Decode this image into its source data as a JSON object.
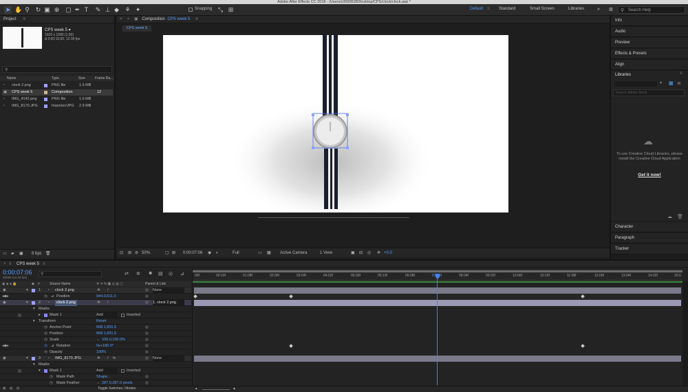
{
  "titlebar": {
    "title": "Adobe After Effects CC 2018 - /Users/s3699528/Desktop/CPS/clock/clock.aep *"
  },
  "toolbar": {
    "tools": [
      "selection-tool",
      "hand-tool",
      "zoom-tool",
      "rotate-tool",
      "camera-tool",
      "pan-behind-tool",
      "rectangle-tool",
      "pen-tool",
      "type-tool",
      "brush-tool",
      "clone-stamp-tool",
      "eraser-tool",
      "roto-brush-tool",
      "puppet-tool"
    ],
    "snapping_label": "Snapping",
    "workspaces": [
      "Default",
      "Standard",
      "Small Screen",
      "Libraries"
    ],
    "search_placeholder": "Search Help"
  },
  "project": {
    "header": "Project",
    "comp_name": "CPS week 5 ▾",
    "comp_info1": "1920 x 1080 (1.00)",
    "comp_info2": "Δ 0;00;15;00, 12.00 fps",
    "search_placeholder": "",
    "columns": [
      "Name",
      "Type",
      "Size",
      "Frame Ra..."
    ],
    "items": [
      {
        "name": "clock 2.png",
        "type": "PNG file",
        "size": "1.6 MB",
        "fps": "",
        "color": "#a0a0ff"
      },
      {
        "name": "CPS week 5",
        "type": "Composition",
        "size": "",
        "fps": "12",
        "color": "#c8b490"
      },
      {
        "name": "IMG_4142.png",
        "type": "PNG file",
        "size": "1.6 MB",
        "fps": "",
        "color": "#a0a0ff"
      },
      {
        "name": "IMG_8170.JPG",
        "type": "Importer/JPG",
        "size": "2.9 MB",
        "fps": "",
        "color": "#a0a0ff"
      }
    ],
    "bpc": "8 bpc"
  },
  "composition": {
    "header_prefix": "Composition",
    "header_name": "CPS week 5",
    "tab": "CPS week 5",
    "zoom": "50%",
    "timecode": "0:00:07:06",
    "resolution": "Full",
    "camera": "Active Camera",
    "views": "1 View",
    "exposure": "+0.0"
  },
  "right_panels": [
    "Info",
    "Audio",
    "Preview",
    "Effects & Presets",
    "Align",
    "Libraries"
  ],
  "libraries": {
    "search_placeholder": "Search Adobe Stock",
    "message": "To use Creative Cloud Libraries, please install the Creative Cloud Application",
    "link": "Get it now!"
  },
  "right_panels_bottom": [
    "Character",
    "Paragraph",
    "Tracker"
  ],
  "timeline": {
    "tab": "CPS week 5",
    "timecode": "0:00:07:06",
    "timecode_sub": "00090 (12.00 fps)",
    "col_source": "Source Name",
    "col_parent": "Parent & Link",
    "ruler": [
      "00f",
      "00:10f",
      "01:08f",
      "02:06f",
      "03:04f",
      "04:02f",
      "05:00f",
      "05:10f",
      "06:08f",
      "07:06f",
      "08:04f",
      "09:02f",
      "10:00f",
      "10:10f",
      "11:08f",
      "12:06f",
      "13:04f",
      "14:02f",
      "15:0"
    ],
    "toggle_label": "Toggle Switches / Modes",
    "rows": [
      {
        "kind": "layer",
        "num": "1",
        "name": "clock 2.png",
        "parent": "None"
      },
      {
        "kind": "prop",
        "name": "Position",
        "value": "944.0,611.0"
      },
      {
        "kind": "layer",
        "num": "2",
        "name": "clock 2.png",
        "parent": "1. clock 2.png"
      },
      {
        "kind": "group",
        "name": "Masks"
      },
      {
        "kind": "mask",
        "name": "Mask 1",
        "mode": "Add",
        "inverted": "Inverted"
      },
      {
        "kind": "group",
        "name": "Transform",
        "value": "Reset"
      },
      {
        "kind": "prop",
        "name": "Anchor Point",
        "value": "668.1,831.5"
      },
      {
        "kind": "prop",
        "name": "Position",
        "value": "668.1,831.5"
      },
      {
        "kind": "prop",
        "name": "Scale",
        "value": "100.0,100.0%"
      },
      {
        "kind": "prop",
        "name": "Rotation",
        "value": "0x+180.0°"
      },
      {
        "kind": "prop",
        "name": "Opacity",
        "value": "100%"
      },
      {
        "kind": "layer",
        "num": "3",
        "name": "IMG_8170.JPG",
        "parent": "None"
      },
      {
        "kind": "group",
        "name": "Masks"
      },
      {
        "kind": "mask",
        "name": "Mask 1",
        "mode": "Add",
        "inverted": "Inverted"
      },
      {
        "kind": "prop",
        "name": "Mask Path",
        "value": "Shape..."
      },
      {
        "kind": "prop",
        "name": "Mask Feather",
        "value": "287.0,287.0 pixels"
      }
    ]
  }
}
